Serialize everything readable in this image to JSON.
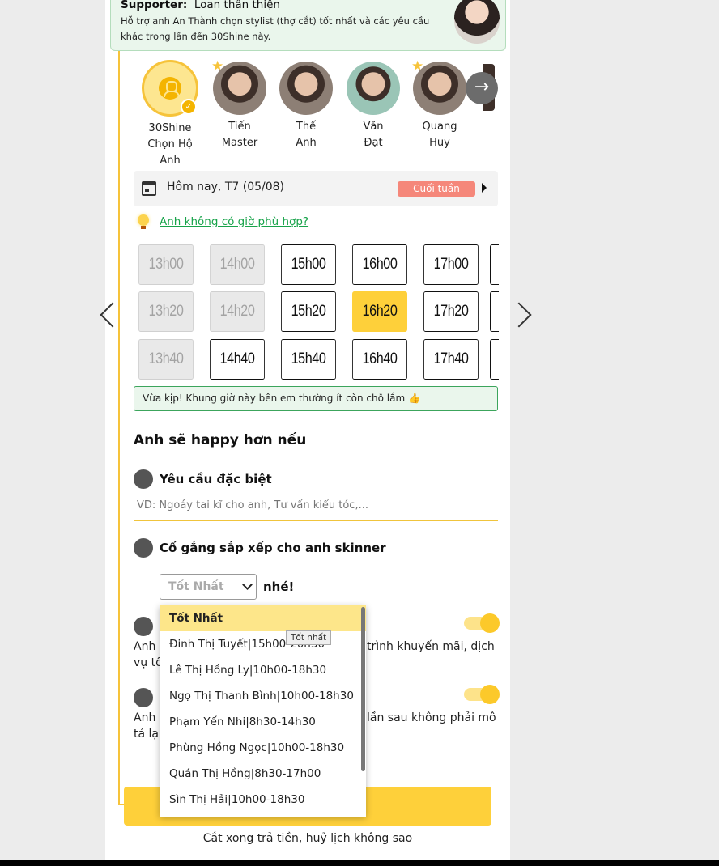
{
  "supporter": {
    "label": "Supporter:",
    "name": "Loan thân thiện",
    "description": "Hỗ trợ anh An Thành chọn stylist (thợ cắt) tốt nhất và các yêu cầu khác trong lần đến 30Shine này."
  },
  "stylists": [
    {
      "line1": "30Shine",
      "line2": "Chọn Hộ Anh",
      "selected": true
    },
    {
      "line1": "Tiến",
      "line2": "Master",
      "star": true
    },
    {
      "line1": "Thế",
      "line2": "Anh"
    },
    {
      "line1": "Văn",
      "line2": "Đạt"
    },
    {
      "line1": "Quang",
      "line2": "Huy",
      "star": true
    }
  ],
  "date": {
    "text": "Hôm nay, T7 (05/08)",
    "badge": "Cuối tuần"
  },
  "help_link": "Anh không có giờ phù hợp?",
  "slots": {
    "row1": [
      {
        "t": "13h00",
        "s": "disabled"
      },
      {
        "t": "14h00",
        "s": "disabled"
      },
      {
        "t": "15h00",
        "s": "normal"
      },
      {
        "t": "16h00",
        "s": "normal"
      },
      {
        "t": "17h00",
        "s": "normal"
      }
    ],
    "row2": [
      {
        "t": "13h20",
        "s": "disabled"
      },
      {
        "t": "14h20",
        "s": "disabled"
      },
      {
        "t": "15h20",
        "s": "normal"
      },
      {
        "t": "16h20",
        "s": "selected"
      },
      {
        "t": "17h20",
        "s": "normal"
      }
    ],
    "row3": [
      {
        "t": "13h40",
        "s": "disabled"
      },
      {
        "t": "14h40",
        "s": "normal"
      },
      {
        "t": "15h40",
        "s": "normal"
      },
      {
        "t": "16h40",
        "s": "normal"
      },
      {
        "t": "17h40",
        "s": "normal"
      }
    ]
  },
  "notice": "Vừa kịp! Khung giờ này bên em thường ít còn chỗ lắm 👍",
  "happy_title": "Anh sẽ happy hơn nếu",
  "special_request": {
    "label": "Yêu cầu đặc biệt",
    "placeholder": "VD: Ngoáy tai kĩ cho anh, Tư vấn kiểu tóc,..."
  },
  "skinner": {
    "label": "Cố gắng sắp xếp cho anh skinner",
    "select_value": "Tốt Nhất",
    "suffix": "nhé!"
  },
  "consult": {
    "line1_left": "Anh c",
    "line1_right": "trình khuyến mãi, dịch",
    "line2": "vụ tố"
  },
  "photo": {
    "line1_left": "Anh c",
    "line1_right": "lần sau không phải mô",
    "line2": "tả lại"
  },
  "colors": {
    "accent": "#fed03a",
    "green": "#18a34a",
    "weekend": "#f5877a"
  },
  "dropdown": {
    "tooltip": "Tốt nhất",
    "options": [
      "Tốt Nhất",
      "Đinh Thị Tuyết|15h00-20h30",
      "Lê Thị Hồng Ly|10h00-18h30",
      "Ngọ Thị Thanh Bình|10h00-18h30",
      "Phạm Yến Nhi|8h30-14h30",
      "Phùng Hồng Ngọc|10h00-18h30",
      "Quán Thị Hồng|8h30-17h00",
      "Sìn Thị Hải|10h00-18h30"
    ]
  },
  "footnote": "Cắt xong trả tiền, huỷ lịch không sao"
}
